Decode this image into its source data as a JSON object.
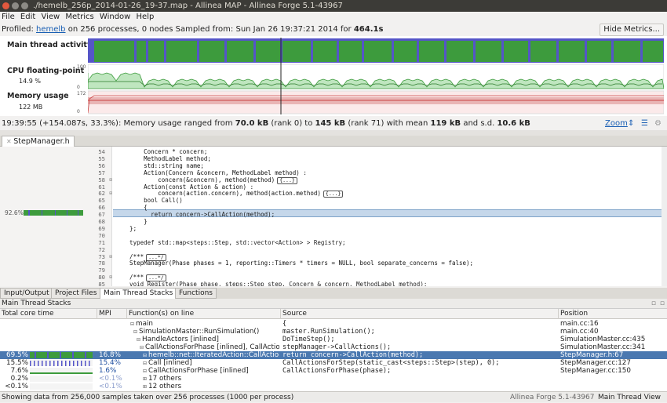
{
  "window": {
    "title": "./hemelb_256p_2014-01-26_19-37.map - Allinea MAP - Allinea Forge 5.1-43967"
  },
  "menu": [
    "File",
    "Edit",
    "View",
    "Metrics",
    "Window",
    "Help"
  ],
  "profile": {
    "prefix": "Profiled: ",
    "app": "hemelb",
    "middle": " on 256 processes, 0 nodes  Sampled from: Sun Jan 26 19:37:21 2014 for ",
    "duration": "464.1s",
    "hide_metrics": "Hide Metrics..."
  },
  "metrics": [
    {
      "label": "Main thread activity",
      "sub": ""
    },
    {
      "label": "CPU floating-point",
      "sub": "14.9 %",
      "tick_top": "100",
      "tick_bottom": "0"
    },
    {
      "label": "Memory usage",
      "sub": "122 MB",
      "tick_top": "172",
      "tick_bottom": "0"
    }
  ],
  "status": {
    "time": "19:39:55 (+154.087s, 33.3%): Memory usage ranged from ",
    "min": "70.0 kB",
    "rank0": " (rank 0) to ",
    "max": "145 kB",
    "rank71": " (rank 71) with mean ",
    "mean": "119 kB",
    "sd_label": " and s.d. ",
    "sd": "10.6 kB",
    "zoom": "Zoom"
  },
  "source_tab": "StepManager.h",
  "source_pct": "92.6%",
  "source_lines": [
    {
      "n": "54",
      "code": "        Concern * concern;"
    },
    {
      "n": "55",
      "code": "        MethodLabel method;"
    },
    {
      "n": "56",
      "code": "        std::string name;"
    },
    {
      "n": "57",
      "code": "        Action(Concern &concern, MethodLabel method) :"
    },
    {
      "n": "58",
      "code": "            concern(&concern), method(method)",
      "fold": "{...}"
    },
    {
      "n": "61",
      "code": "        Action(const Action & action) :"
    },
    {
      "n": "62",
      "code": "            concern(action.concern), method(action.method)",
      "fold": "{...}"
    },
    {
      "n": "65",
      "code": "        bool Call()"
    },
    {
      "n": "66",
      "code": "        {"
    },
    {
      "n": "67",
      "code": "          return concern->CallAction(method);"
    },
    {
      "n": "68",
      "code": "        }"
    },
    {
      "n": "69",
      "code": "    };"
    },
    {
      "n": "70",
      "code": ""
    },
    {
      "n": "71",
      "code": "    typedef std::map<steps::Step, std::vector<Action> > Registry;"
    },
    {
      "n": "72",
      "code": ""
    },
    {
      "n": "73",
      "code": "    /***",
      "fold": "...*/"
    },
    {
      "n": "78",
      "code": "    StepManager(Phase phases = 1, reporting::Timers * timers = NULL, bool separate_concerns = false);"
    },
    {
      "n": "79",
      "code": ""
    },
    {
      "n": "80",
      "code": "    /***",
      "fold": "...*/"
    },
    {
      "n": "85",
      "code": "    void Register(Phase phase, steps::Step step, Concern & concern, MethodLabel method);"
    }
  ],
  "bottom_tabs": [
    "Input/Output",
    "Project Files",
    "Main Thread Stacks",
    "Functions"
  ],
  "panel_title": "Main Thread Stacks",
  "columns": [
    "Total core time",
    "MPI",
    "Function(s) on line",
    "Source",
    "Position"
  ],
  "rows": [
    {
      "pct": "",
      "mpi": "",
      "fn": "main",
      "src": "{",
      "pos": "main.cc:16",
      "indent": 0
    },
    {
      "pct": "",
      "mpi": "",
      "fn": "SimulationMaster::RunSimulation()",
      "src": "master.RunSimulation();",
      "pos": "main.cc:40",
      "indent": 1
    },
    {
      "pct": "",
      "mpi": "",
      "fn": "HandleActors [inlined]",
      "src": "DoTimeStep();",
      "pos": "SimulationMaster.cc:435",
      "indent": 2
    },
    {
      "pct": "",
      "mpi": "",
      "fn": "CallActionsForPhase [inlined], CallAction...",
      "src": "stepManager->CallActions();",
      "pos": "SimulationMaster.cc:341",
      "indent": 3
    },
    {
      "pct": "69.5%",
      "mpi": "16.8%",
      "fn": "hemelb::net::IteratedAction::CallAction...",
      "src": "return concern->CallAction(method);",
      "pos": "StepManager.h:67",
      "indent": 4,
      "sel": true
    },
    {
      "pct": "15.5%",
      "mpi": "15.4%",
      "fn": "Call [inlined]",
      "src": "CallActionsForStep(static_cast<steps::Step>(step), 0);",
      "pos": "StepManager.cc:127",
      "indent": 4
    },
    {
      "pct": "7.6%",
      "mpi": "1.6%",
      "fn": "CallActionsForPhase [inlined]",
      "src": "CallActionsForPhase(phase);",
      "pos": "StepManager.cc:150",
      "indent": 4
    },
    {
      "pct": "0.2%",
      "mpi": "<0.1%",
      "fn": "17 others",
      "src": "",
      "pos": "",
      "indent": 4
    },
    {
      "pct": "<0.1%",
      "mpi": "<0.1%",
      "fn": "12 others",
      "src": "",
      "pos": "",
      "indent": 4
    }
  ],
  "footer": {
    "left": "Showing data from 256,000 samples taken over 256 processes (1000 per process)",
    "version": "Allinea Forge 5.1-43967",
    "view": "Main Thread View"
  },
  "colors": {
    "green": "#3d9b3d",
    "blue": "#5555c8",
    "selection": "#4a78b0",
    "memory": "#d98a8a"
  }
}
